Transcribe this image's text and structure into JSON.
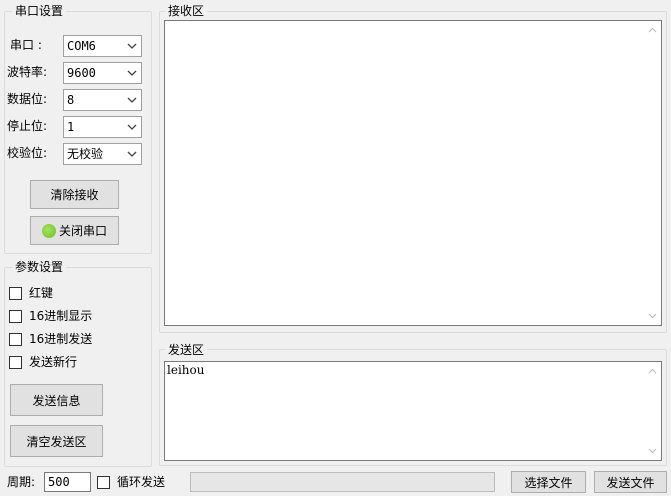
{
  "serial": {
    "title": "串口设置",
    "port_label": "串口  :",
    "port_value": "COM6",
    "baud_label": "波特率:",
    "baud_value": "9600",
    "databits_label": "数据位:",
    "databits_value": "8",
    "stopbits_label": "停止位:",
    "stopbits_value": "1",
    "parity_label": "校验位:",
    "parity_value": "无校验",
    "clear_receive": "清除接收",
    "close_port": "关闭串口"
  },
  "params": {
    "title": "参数设置",
    "options": [
      "红键",
      "16进制显示",
      "16进制发送",
      "发送新行"
    ],
    "send_info": "发送信息",
    "clear_send": "清空发送区"
  },
  "receive": {
    "title": "接收区",
    "content": ""
  },
  "send": {
    "title": "发送区",
    "content": "leihou"
  },
  "bottom": {
    "period_label": "周期:",
    "period_value": "500",
    "loop_send": "循环发送",
    "select_file": "选择文件",
    "send_file": "发送文件"
  },
  "colors": {
    "led": "#7cc832"
  }
}
